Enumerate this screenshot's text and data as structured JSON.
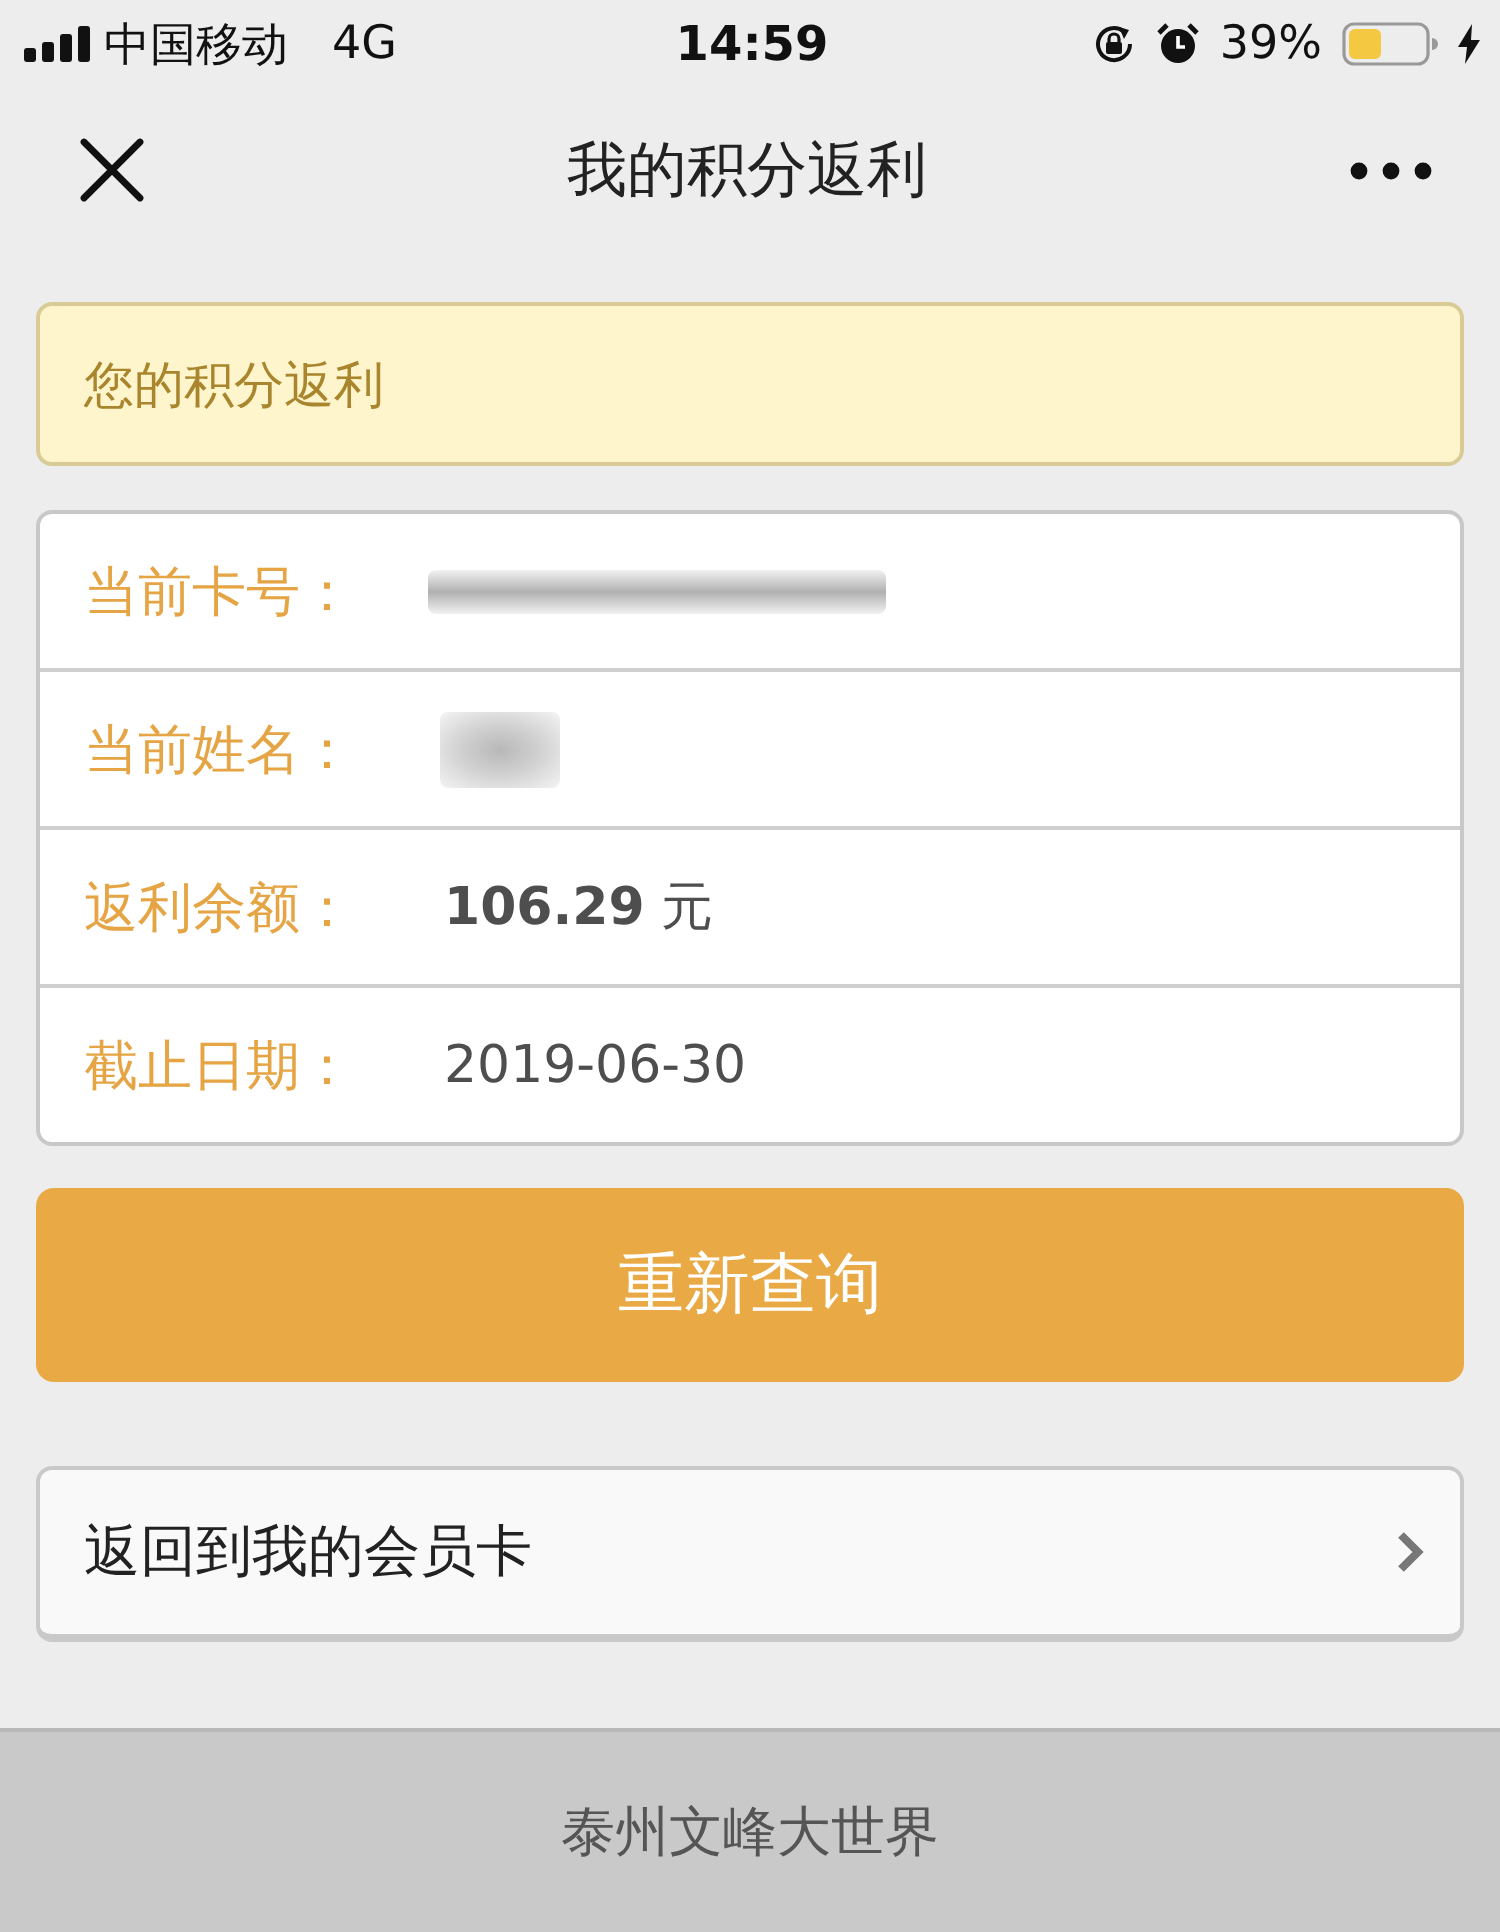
{
  "status_bar": {
    "carrier": "中国移动",
    "network": "4G",
    "time": "14:59",
    "battery": "39%"
  },
  "nav_bar": {
    "title": "我的积分返利"
  },
  "notice": {
    "text": "您的积分返利"
  },
  "info_rows": [
    {
      "label": "当前卡号：",
      "kind": "blurred_wide"
    },
    {
      "label": "当前姓名：",
      "kind": "blurred_short"
    },
    {
      "label": "返利余额：",
      "kind": "text",
      "value": "**106.29** 元"
    },
    {
      "label": "截止日期：",
      "kind": "text",
      "value": "2019-06-30"
    }
  ],
  "query_button": {
    "label": "重新查询"
  },
  "link_row": {
    "label": "返回到我的会员卡"
  },
  "footer": {
    "text": "泰州文峰大世界"
  }
}
